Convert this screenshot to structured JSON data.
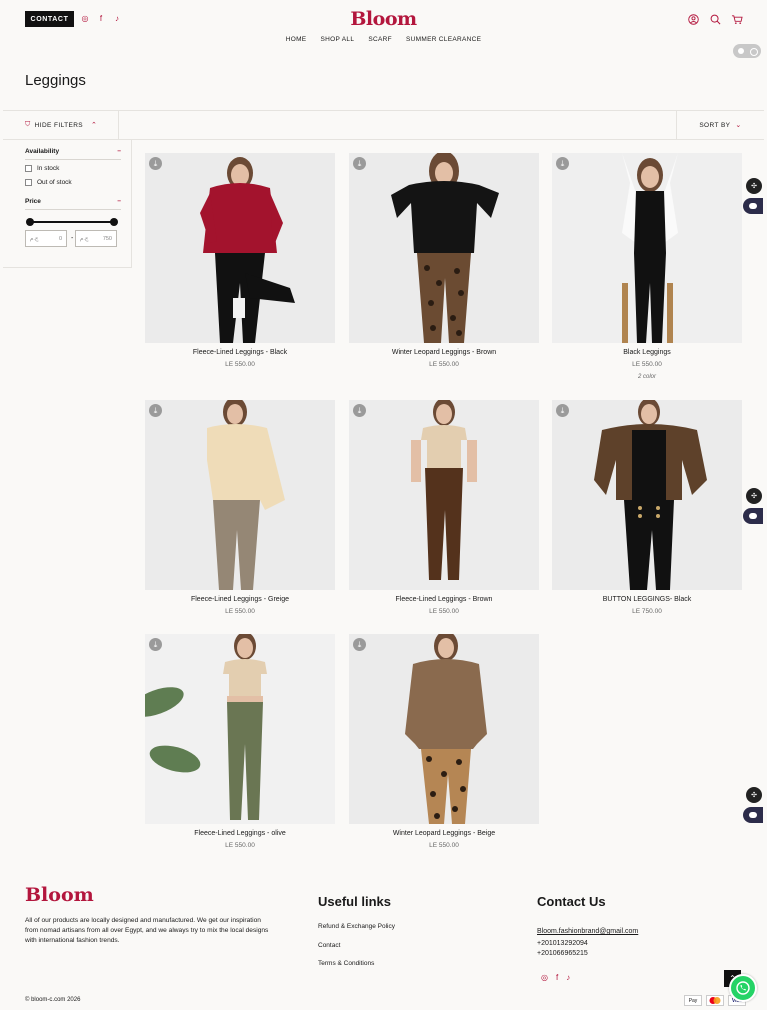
{
  "header": {
    "contact_label": "CONTACT",
    "social_icons": [
      "instagram-icon",
      "facebook-icon",
      "tiktok-icon"
    ],
    "logo": "Bloom",
    "nav": [
      "HOME",
      "SHOP ALL",
      "SCARF",
      "SUMMER CLEARANCE"
    ],
    "icons": [
      "account-icon",
      "search-icon",
      "cart-icon"
    ]
  },
  "page": {
    "title": "Leggings"
  },
  "filterbar": {
    "hide_filters": "HIDE FILTERS",
    "sort_by": "SORT BY"
  },
  "filters": {
    "availability": {
      "title": "Availability",
      "options": [
        "In stock",
        "Out of stock"
      ]
    },
    "price": {
      "title": "Price",
      "currency": "ج.م",
      "min_placeholder": "0",
      "max_placeholder": "750"
    }
  },
  "products": [
    {
      "name": "Fleece-Lined Leggings - Black",
      "price": "LE 550.00"
    },
    {
      "name": "Winter Leopard Leggings - Brown",
      "price": "LE 550.00"
    },
    {
      "name": "Black Leggings",
      "price": "LE 550.00",
      "colors": "2 color"
    },
    {
      "name": "Fleece-Lined Leggings - Greige",
      "price": "LE 550.00"
    },
    {
      "name": "Fleece-Lined Leggings - Brown",
      "price": "LE 550.00"
    },
    {
      "name": "BUTTON LEGGINGS- Black",
      "price": "LE 750.00"
    },
    {
      "name": "Fleece-Lined Leggings - olive",
      "price": "LE 550.00"
    },
    {
      "name": "Winter Leopard Leggings - Beige",
      "price": "LE 550.00"
    }
  ],
  "footer": {
    "logo": "Bloom",
    "description": "All of our products are locally designed and manufactured. We get our inspiration from nomad artisans from all over Egypt, and we always try to mix the local designs with international fashion trends.",
    "useful_links_title": "Useful links",
    "links": [
      "Refund & Exchange Policy",
      "Contact",
      "Terms & Conditions"
    ],
    "contact_title": "Contact Us",
    "email": "Bloom.fashionbrand@gmail.com",
    "phones": [
      "+201013292094",
      "+201066965215"
    ],
    "copyright": "© bloom-c.com 2026",
    "payments": [
      "Pay",
      "MC",
      "Visa"
    ]
  },
  "colors": {
    "brand": "#b3163d",
    "background": "#faf9f7"
  }
}
